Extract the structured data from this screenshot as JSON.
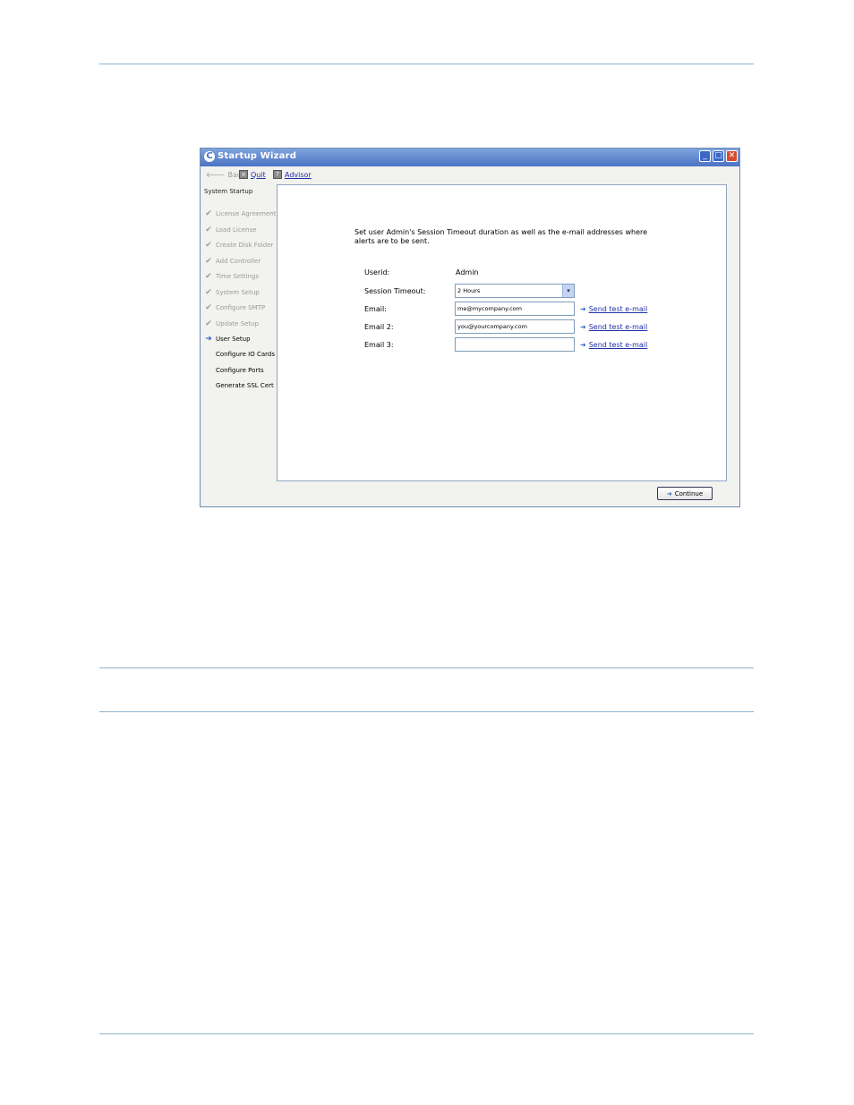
{
  "window": {
    "title": "Startup Wizard",
    "controls": {
      "minimize": "_",
      "maximize": "□",
      "close": "✕"
    }
  },
  "toolbar": {
    "back_label": "Back",
    "quit_label": "Quit",
    "advisor_label": "Advisor"
  },
  "sidebar": {
    "heading": "System Startup",
    "items": [
      {
        "label": "License Agreement",
        "state": "done"
      },
      {
        "label": "Load License",
        "state": "done"
      },
      {
        "label": "Create Disk Folder",
        "state": "done"
      },
      {
        "label": "Add Controller",
        "state": "done"
      },
      {
        "label": "Time Settings",
        "state": "done"
      },
      {
        "label": "System Setup",
        "state": "done"
      },
      {
        "label": "Configure SMTP",
        "state": "done"
      },
      {
        "label": "Update Setup",
        "state": "done"
      },
      {
        "label": "User Setup",
        "state": "current"
      },
      {
        "label": "Configure IO Cards",
        "state": "pending"
      },
      {
        "label": "Configure Ports",
        "state": "pending"
      },
      {
        "label": "Generate SSL Cert",
        "state": "pending"
      }
    ]
  },
  "form": {
    "intro": "Set user Admin's Session Timeout duration as well as the e-mail addresses where alerts are to be sent.",
    "userid_label": "Userid:",
    "userid_value": "Admin",
    "timeout_label": "Session Timeout:",
    "timeout_value": "2 Hours",
    "email_label": "Email:",
    "email_value": "me@mycompany.com",
    "email2_label": "Email 2:",
    "email2_value": "you@yourcompany.com",
    "email3_label": "Email 3:",
    "email3_value": "",
    "send_test_label": " Send test e-mail "
  },
  "footer": {
    "continue_label": "Continue"
  },
  "icons": {
    "check": "check-icon",
    "current": "arrow-right-icon",
    "send": "arrow-right-icon"
  }
}
